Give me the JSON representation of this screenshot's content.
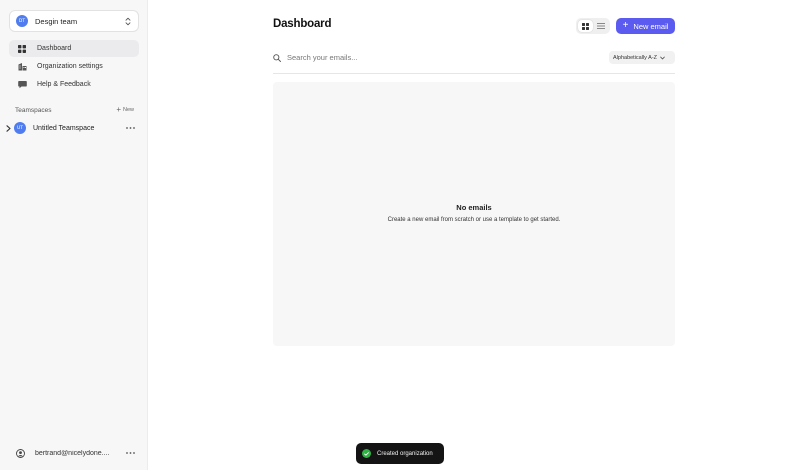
{
  "sidebar": {
    "org": {
      "initials": "DT",
      "name": "Desgin team"
    },
    "nav": [
      {
        "label": "Dashboard",
        "icon": "grid-icon"
      },
      {
        "label": "Organization settings",
        "icon": "building-icon"
      },
      {
        "label": "Help & Feedback",
        "icon": "chat-icon"
      }
    ],
    "teamspaces": {
      "header": "Teamspaces",
      "new_label": "New",
      "items": [
        {
          "initials": "UT",
          "name": "Untitled Teamspace"
        }
      ]
    },
    "user": {
      "email": "bertrand@nicelydone...."
    }
  },
  "main": {
    "title": "Dashboard",
    "new_email_label": "New email",
    "search": {
      "placeholder": "Search your emails..."
    },
    "sort": {
      "selected": "Alphabetically A-Z"
    },
    "empty": {
      "title": "No emails",
      "description": "Create a new email from scratch or use a template to get started."
    }
  },
  "toast": {
    "message": "Created organization"
  },
  "colors": {
    "accent": "#5b5bf0",
    "avatar": "#4f7df0",
    "success": "#2fb344"
  }
}
